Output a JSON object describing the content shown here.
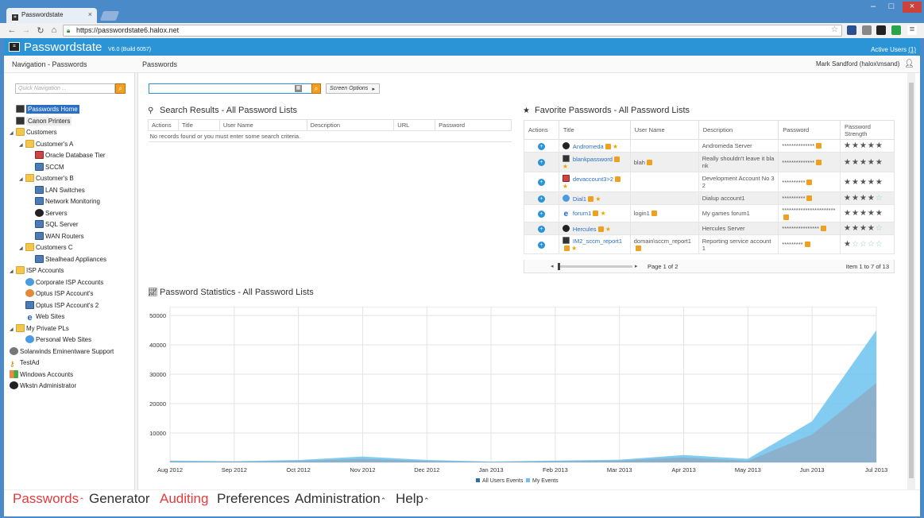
{
  "browser": {
    "tab_title": "Passwordstate",
    "url": "https://passwordstate6.halox.net"
  },
  "header": {
    "brand": "Passwordstate",
    "version": "V6.0 (Build 6057)",
    "active_users_label": "Active Users",
    "active_users_count": "(1)"
  },
  "subheader": {
    "left_title": "Navigation - Passwords",
    "main_title": "Passwords",
    "user": "Mark Sandford (halox\\msand)"
  },
  "sidebar": {
    "quick_nav_placeholder": "Quick Navigation ...",
    "tree": [
      {
        "label": "Passwords Home",
        "icon": "passwordstate-icon"
      },
      {
        "label": "Canon Printers",
        "icon": "printer-icon"
      },
      {
        "label": "Customers",
        "icon": "folder-icon"
      },
      {
        "label": "Customer's A",
        "icon": "folder-icon"
      },
      {
        "label": "Oracle Database Tier",
        "icon": "database-icon"
      },
      {
        "label": "SCCM",
        "icon": "server-icon"
      },
      {
        "label": "Customer's B",
        "icon": "folder-icon"
      },
      {
        "label": "LAN Switches",
        "icon": "network-icon"
      },
      {
        "label": "Network Monitoring",
        "icon": "network-icon"
      },
      {
        "label": "Servers",
        "icon": "dell-icon"
      },
      {
        "label": "SQL Server",
        "icon": "sql-icon"
      },
      {
        "label": "WAN Routers",
        "icon": "router-icon"
      },
      {
        "label": "Customers C",
        "icon": "folder-icon"
      },
      {
        "label": "Stealhead Appliances",
        "icon": "network-icon"
      },
      {
        "label": "ISP Accounts",
        "icon": "folder-icon"
      },
      {
        "label": "Corporate ISP Accounts",
        "icon": "globe-icon"
      },
      {
        "label": "Optus ISP Account's",
        "icon": "people-icon"
      },
      {
        "label": "Optus ISP Account's 2",
        "icon": "phone-icon"
      },
      {
        "label": "Web Sites",
        "icon": "ie-icon"
      },
      {
        "label": "My Private PLs",
        "icon": "folder-icon"
      },
      {
        "label": "Personal Web Sites",
        "icon": "globe-icon"
      },
      {
        "label": "Solarwinds Eminentware Support",
        "icon": "gear-icon"
      },
      {
        "label": "TestAd",
        "icon": "key-icon"
      },
      {
        "label": "Windows Accounts",
        "icon": "windows-icon"
      },
      {
        "label": "Wkstn Administrator",
        "icon": "dell-icon"
      }
    ]
  },
  "toolbar": {
    "screen_options": "Screen Options"
  },
  "search_results": {
    "title": "Search Results - All Password Lists",
    "columns": [
      "Actions",
      "Title",
      "User Name",
      "Description",
      "URL",
      "Password"
    ],
    "empty_text": "No records found or you must enter some search criteria."
  },
  "favorites": {
    "title": "Favorite Passwords - All Password Lists",
    "columns": [
      "Actions",
      "Title",
      "User Name",
      "Description",
      "Password",
      "Password Strength"
    ],
    "rows": [
      {
        "title": "Andromeda",
        "user": "",
        "desc": "Andromeda Server",
        "pwd": "**************",
        "stars": 5
      },
      {
        "title": "blankpassword",
        "user": "blah",
        "desc": "Really shouldn't leave it blank",
        "pwd": "**************",
        "stars": 5
      },
      {
        "title": "devaccount3>2",
        "user": "",
        "desc": "Development Account No 32",
        "pwd": "**********",
        "stars": 5
      },
      {
        "title": "Dial1",
        "user": "",
        "desc": "Dialup account1",
        "pwd": "**********",
        "stars": 4
      },
      {
        "title": "forum1",
        "user": "login1",
        "desc": "My games forum1",
        "pwd": "***********************",
        "stars": 5
      },
      {
        "title": "Hercules",
        "user": "",
        "desc": "Hercules Server",
        "pwd": "****************",
        "stars": 4
      },
      {
        "title": "IM2_sccm_report1",
        "user": "domain\\sccm_report1",
        "desc": "Reporting service account 1",
        "pwd": "*********",
        "stars": 1
      }
    ],
    "pager_page": "Page 1 of 2",
    "pager_items": "Item 1 to 7 of 13"
  },
  "statistics": {
    "title": "Password Statistics - All Password Lists"
  },
  "chart_data": {
    "type": "area",
    "title": "",
    "x": [
      "Aug 2012",
      "Sep 2012",
      "Oct 2012",
      "Nov 2012",
      "Dec 2012",
      "Jan 2013",
      "Feb 2013",
      "Mar 2013",
      "Apr 2013",
      "May 2013",
      "Jun 2013",
      "Jul 2013"
    ],
    "yticks": [
      10000,
      20000,
      30000,
      40000,
      50000
    ],
    "ylim": [
      0,
      53000
    ],
    "series": [
      {
        "name": "All Users Events",
        "color": "#8fa8c0",
        "values": [
          400,
          300,
          500,
          1200,
          500,
          200,
          400,
          600,
          1700,
          500,
          9500,
          27000
        ]
      },
      {
        "name": "My Events",
        "color": "#6cc3ef",
        "values": [
          600,
          400,
          800,
          2000,
          800,
          300,
          600,
          900,
          2500,
          1200,
          14000,
          45000
        ]
      }
    ],
    "grid": true,
    "legend": "bottom"
  },
  "footer_nav": {
    "passwords": "Passwords",
    "generator": "Generator",
    "auditing": "Auditing",
    "preferences": "Preferences",
    "administration": "Administration",
    "help": "Help"
  }
}
